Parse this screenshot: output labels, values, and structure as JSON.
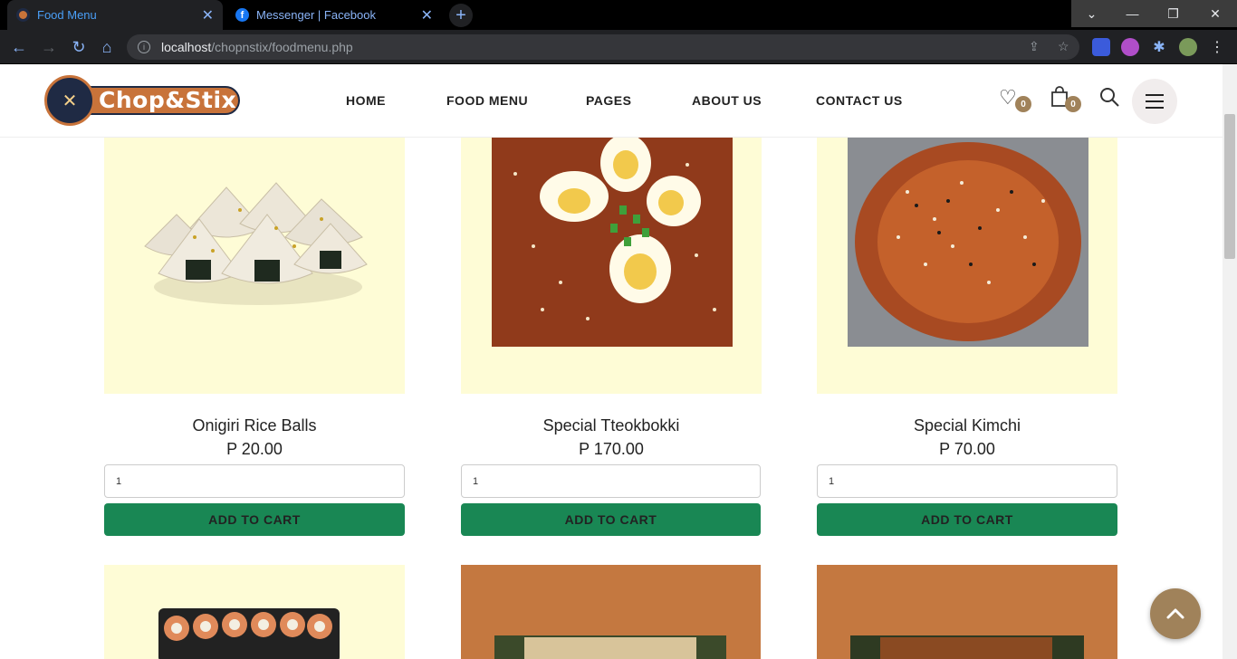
{
  "browser": {
    "tabs": [
      {
        "title": "Food Menu",
        "active": true
      },
      {
        "title": "Messenger | Facebook",
        "active": false
      }
    ],
    "url_host": "localhost",
    "url_path": "/chopnstix/foodmenu.php"
  },
  "site": {
    "logo_text": "Chop&Stix",
    "nav": [
      "HOME",
      "FOOD MENU",
      "PAGES",
      "ABOUT US",
      "CONTACT US"
    ],
    "wishlist_count": "0",
    "cart_count": "0"
  },
  "products": [
    {
      "name": "Onigiri Rice Balls",
      "price": "P 20.00",
      "qty": "1",
      "button": "ADD TO CART"
    },
    {
      "name": "Special Tteokbokki",
      "price": "P 170.00",
      "qty": "1",
      "button": "ADD TO CART"
    },
    {
      "name": "Special Kimchi",
      "price": "P 70.00",
      "qty": "1",
      "button": "ADD TO CART"
    }
  ],
  "colors": {
    "image_bg_yellow": "#fefcd6",
    "image_bg_brown": "#c47840",
    "add_button": "#198754",
    "accent": "#a0825a"
  }
}
